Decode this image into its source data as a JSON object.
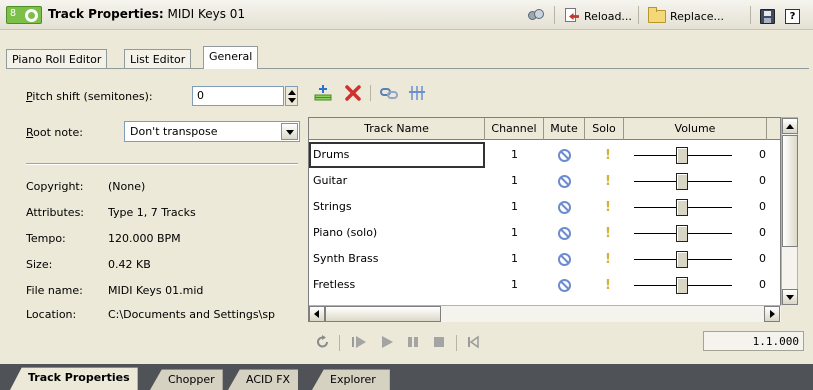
{
  "window": {
    "badge_number": "8",
    "title_bold": "Track Properties:",
    "title_rest": " MIDI Keys 01"
  },
  "header_actions": {
    "reload_label": "Reload...",
    "replace_label": "Replace..."
  },
  "tabs": [
    {
      "label": "Piano Roll Editor",
      "active": false
    },
    {
      "label": "List Editor",
      "active": false
    },
    {
      "label": "General",
      "active": true
    }
  ],
  "form": {
    "pitch_label_prefix": "P",
    "pitch_label_rest": "itch shift (semitones):",
    "pitch_value": "0",
    "root_label_prefix": "R",
    "root_label_rest": "oot note:",
    "root_value": "Don't transpose"
  },
  "info": {
    "copyright_label": "Copyright:",
    "copyright_value": "(None)",
    "attributes_label": "Attributes:",
    "attributes_value": "Type 1, 7 Tracks",
    "tempo_label": "Tempo:",
    "tempo_value": "120.000 BPM",
    "size_label": "Size:",
    "size_value": "0.42 KB",
    "filename_label": "File name:",
    "filename_value": "MIDI Keys 01.mid",
    "location_label": "Location:",
    "location_value": "C:\\Documents and Settings\\sp"
  },
  "grid": {
    "columns": [
      "Track Name",
      "Channel",
      "Mute",
      "Solo",
      "Volume"
    ],
    "rows": [
      {
        "name": "Drums",
        "channel": "1",
        "volume": "0"
      },
      {
        "name": "Guitar",
        "channel": "1",
        "volume": "0"
      },
      {
        "name": "Strings",
        "channel": "1",
        "volume": "0"
      },
      {
        "name": "Piano (solo)",
        "channel": "1",
        "volume": "0"
      },
      {
        "name": "Synth Brass",
        "channel": "1",
        "volume": "0"
      },
      {
        "name": "Fretless",
        "channel": "1",
        "volume": "0"
      }
    ]
  },
  "transport": {
    "position": "1.1.000"
  },
  "bottom_tabs": [
    {
      "label": "Track Properties",
      "active": true
    },
    {
      "label": "Chopper",
      "active": false
    },
    {
      "label": "ACID FX",
      "active": false
    },
    {
      "label": "Explorer",
      "active": false
    }
  ],
  "colors": {
    "accent_green": "#7cc04a",
    "mute_blue": "#6d8bd0",
    "solo_gold": "#d4b23a",
    "delete_red": "#d0312d"
  }
}
